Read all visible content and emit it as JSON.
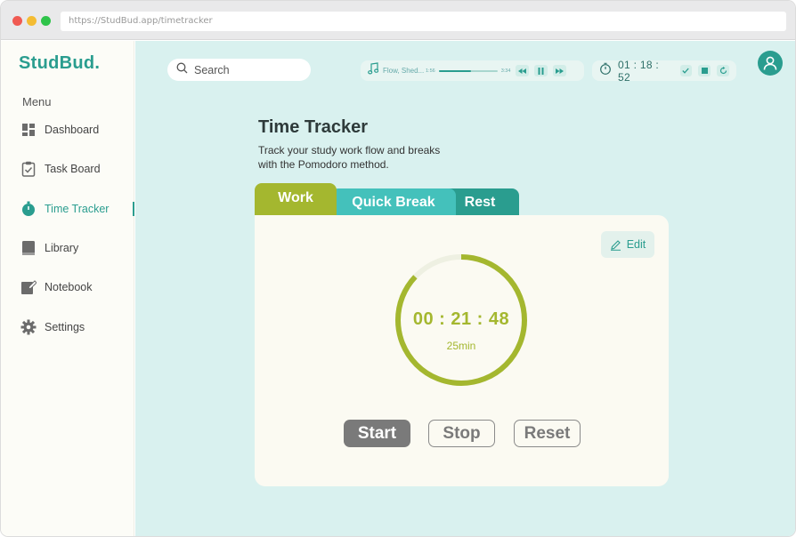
{
  "browser": {
    "url": "https://StudBud.app/timetracker"
  },
  "sidebar": {
    "logo": "StudBud.",
    "menu_label": "Menu",
    "items": [
      {
        "label": "Dashboard",
        "icon": "dashboard-icon"
      },
      {
        "label": "Task Board",
        "icon": "clipboard-icon"
      },
      {
        "label": "Time Tracker",
        "icon": "timer-icon",
        "active": true
      },
      {
        "label": "Library",
        "icon": "book-icon"
      },
      {
        "label": "Notebook",
        "icon": "notebook-icon"
      },
      {
        "label": "Settings",
        "icon": "gear-icon"
      }
    ]
  },
  "header": {
    "search_placeholder": "Search",
    "player": {
      "track": "Flow, Shed...",
      "elapsed": "1:56",
      "duration": "3:34",
      "progress": 0.55
    },
    "timer": {
      "time": "01 : 18 : 52"
    }
  },
  "page": {
    "title": "Time Tracker",
    "description": "Track your study work flow and breaks with the Pomodoro method."
  },
  "tabs": [
    {
      "label": "Work",
      "active": true
    },
    {
      "label": "Quick Break"
    },
    {
      "label": "Rest"
    }
  ],
  "timer_card": {
    "edit_label": "Edit",
    "clock": "00 : 21 : 48",
    "duration_label": "25min",
    "progress": 0.87,
    "buttons": {
      "start": "Start",
      "stop": "Stop",
      "reset": "Reset"
    }
  },
  "colors": {
    "brand": "#2a9d8f",
    "work": "#a4b72f",
    "quick_break": "#44c1bb",
    "rest": "#2a9d8f",
    "background": "#d9f1ef"
  }
}
